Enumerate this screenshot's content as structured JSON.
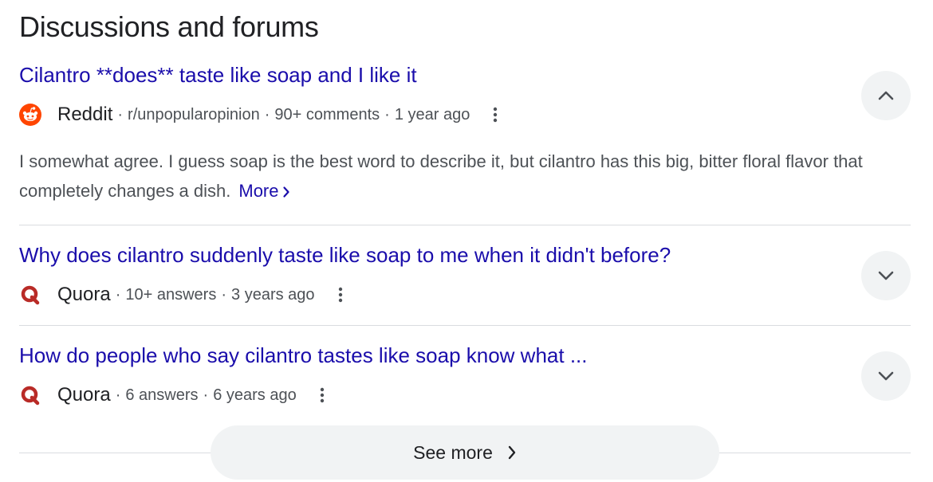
{
  "section": {
    "title": "Discussions and forums"
  },
  "results": [
    {
      "title": "Cilantro **does** taste like soap and I like it",
      "source": "Reddit",
      "sep1": "·",
      "meta1": "r/unpopularopinion",
      "sep2": "·",
      "meta2": "90+ comments",
      "sep3": "·",
      "meta3": "1 year ago",
      "snippet": "I somewhat agree. I guess soap is the best word to describe it, but cilantro has this big, bitter floral flavor that completely changes a dish.",
      "more_label": "More",
      "expanded": true,
      "favicon": "reddit-icon"
    },
    {
      "title": "Why does cilantro suddenly taste like soap to me when it didn't before?",
      "source": "Quora",
      "sep1": "·",
      "meta1": "10+ answers",
      "sep2": "·",
      "meta2": "3 years ago",
      "expanded": false,
      "favicon": "quora-icon"
    },
    {
      "title": "How do people who say cilantro tastes like soap know what ...",
      "source": "Quora",
      "sep1": "·",
      "meta1": "6 answers",
      "sep2": "·",
      "meta2": "6 years ago",
      "expanded": false,
      "favicon": "quora-icon"
    }
  ],
  "see_more": {
    "label": "See more"
  },
  "colors": {
    "link": "#1a0dab",
    "meta_text": "#4d5156",
    "button_bg": "#f1f3f4",
    "divider": "#dadce0",
    "reddit": "#ff4500",
    "quora": "#b92b27"
  }
}
